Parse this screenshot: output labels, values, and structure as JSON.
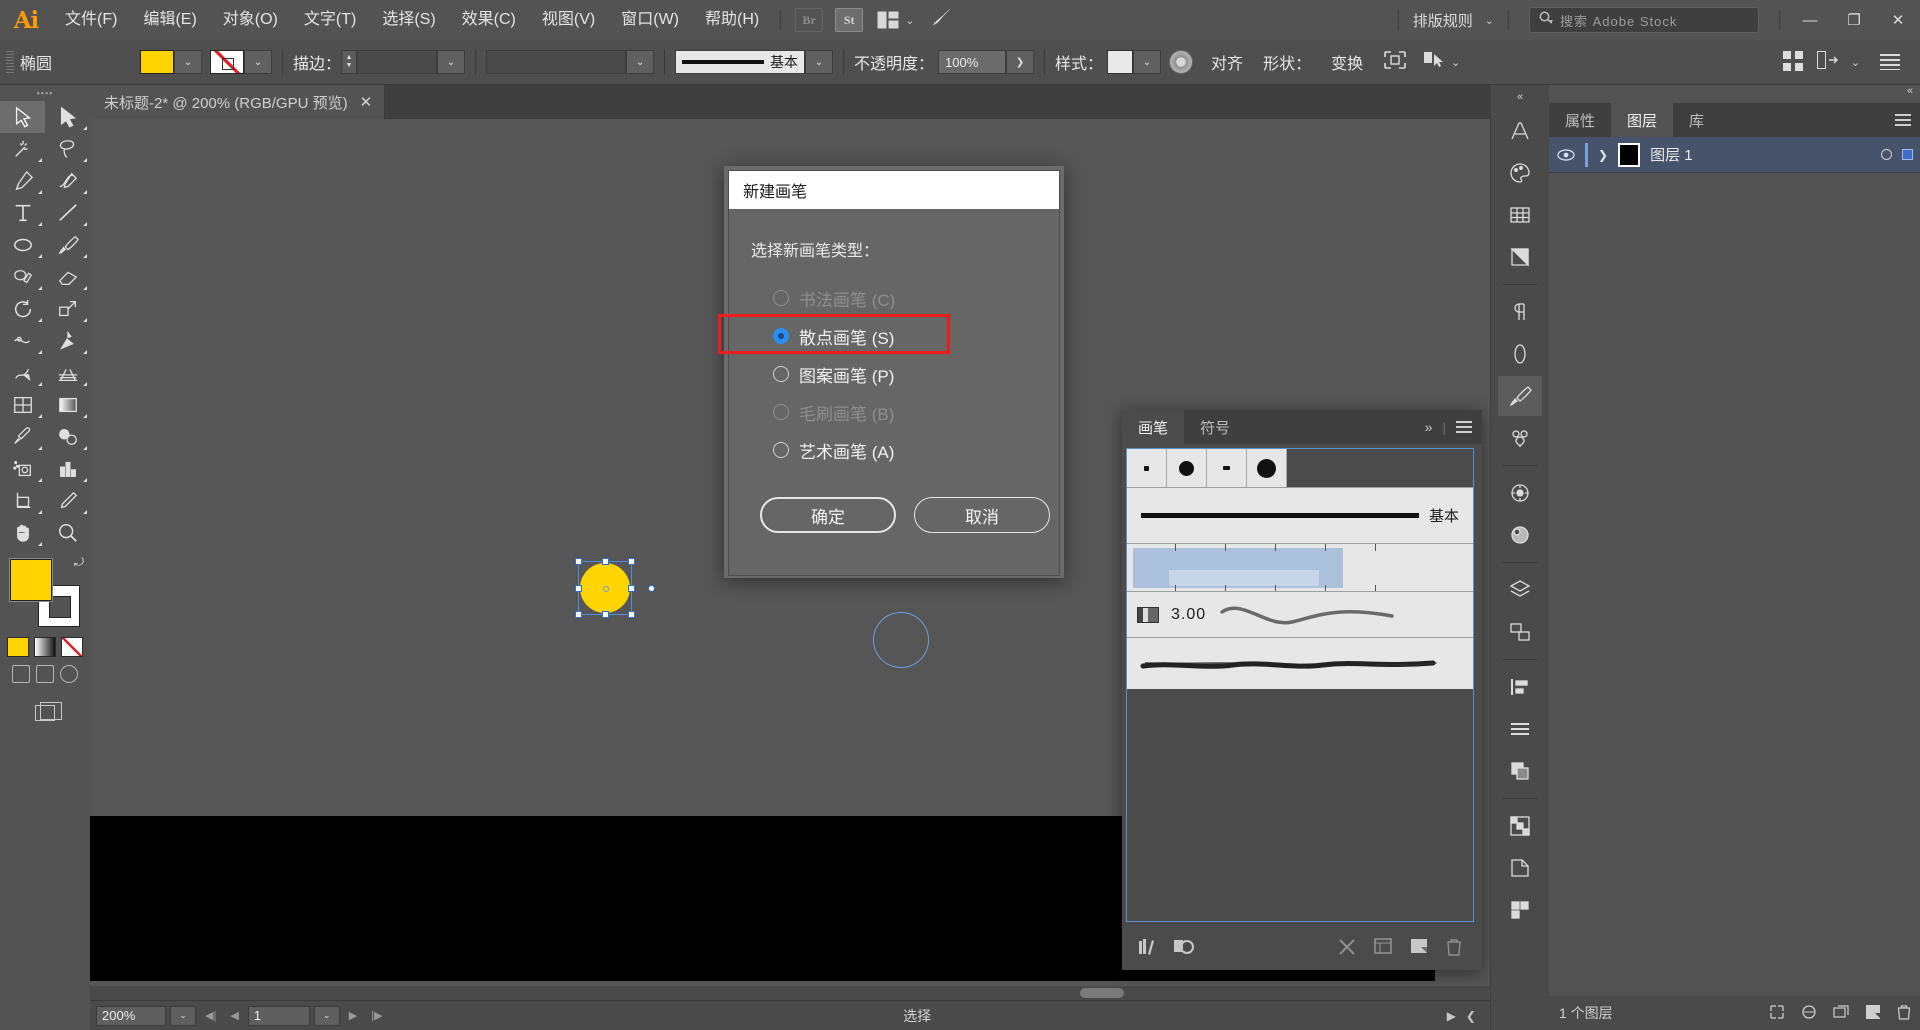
{
  "app": {
    "logo": "Ai"
  },
  "menubar": {
    "items": [
      {
        "label": "文件(F)"
      },
      {
        "label": "编辑(E)"
      },
      {
        "label": "对象(O)"
      },
      {
        "label": "文字(T)"
      },
      {
        "label": "选择(S)"
      },
      {
        "label": "效果(C)"
      },
      {
        "label": "视图(V)"
      },
      {
        "label": "窗口(W)"
      },
      {
        "label": "帮助(H)"
      }
    ],
    "bridge_label": "Br",
    "stock_label": "St",
    "arrange_chevron": "⌄",
    "rocket_icon": "rocket-icon",
    "workspace": "排版规则",
    "workspace_chevron": "⌄",
    "search_placeholder": "搜索 Adobe Stock",
    "minimize": "—",
    "restore": "❐",
    "close": "✕"
  },
  "controlbar": {
    "shape_label": "椭圆",
    "fill_color": "#ffd400",
    "stroke_swatch": "none",
    "stroke_label": "描边：",
    "stroke_weight": "",
    "stroke_profile": "",
    "brush_name": "基本",
    "opacity_label": "不透明度：",
    "opacity_value": "100%",
    "opacity_arrow": "❯",
    "style_label": "样式：",
    "recolor_icon": "recolor-artwork-icon",
    "align_label": "对齐",
    "shape_prop_label": "形状：",
    "transform_label": "变换",
    "isolate_icon": "isolate-icon",
    "select_similar_icon": "select-similar-icon",
    "select_similar_chevron": "⌄",
    "grid_icon": "document-grid-icon",
    "arrange_icon": "arrange-documents-icon",
    "panel_menu_icon": "panel-menu-icon"
  },
  "toolbar": {
    "tools": [
      {
        "name": "selection-tool",
        "selected": true
      },
      {
        "name": "direct-selection-tool",
        "selected": false
      },
      {
        "name": "magic-wand-tool",
        "selected": false
      },
      {
        "name": "lasso-tool",
        "selected": false
      },
      {
        "name": "pen-tool",
        "selected": false
      },
      {
        "name": "curvature-tool",
        "selected": false
      },
      {
        "name": "type-tool",
        "selected": false
      },
      {
        "name": "line-segment-tool",
        "selected": false
      },
      {
        "name": "ellipse-tool",
        "selected": false
      },
      {
        "name": "paintbrush-tool",
        "selected": false
      },
      {
        "name": "shaper-tool",
        "selected": false
      },
      {
        "name": "eraser-tool",
        "selected": false
      },
      {
        "name": "rotate-tool",
        "selected": false
      },
      {
        "name": "scale-tool",
        "selected": false
      },
      {
        "name": "width-tool",
        "selected": false
      },
      {
        "name": "free-transform-tool",
        "selected": false
      },
      {
        "name": "shape-builder-tool",
        "selected": false
      },
      {
        "name": "perspective-grid-tool",
        "selected": false
      },
      {
        "name": "mesh-tool",
        "selected": false
      },
      {
        "name": "gradient-tool",
        "selected": false
      },
      {
        "name": "eyedropper-tool",
        "selected": false
      },
      {
        "name": "blend-tool",
        "selected": false
      },
      {
        "name": "symbol-sprayer-tool",
        "selected": false
      },
      {
        "name": "column-graph-tool",
        "selected": false
      },
      {
        "name": "artboard-tool",
        "selected": false
      },
      {
        "name": "slice-tool",
        "selected": false
      },
      {
        "name": "hand-tool",
        "selected": false
      },
      {
        "name": "zoom-tool",
        "selected": false
      }
    ],
    "fill_color": "#ffd400",
    "stroke_color": "#ffffff"
  },
  "document": {
    "tab_title": "未标题-2* @ 200% (RGB/GPU 预览)",
    "tab_close": "✕"
  },
  "canvas": {
    "selected_object": "yellow-ellipse",
    "object_fill": "#ffd400",
    "blue_outline_circle": "blue-circle-outline"
  },
  "dialog": {
    "title": "新建画笔",
    "subtitle": "选择新画笔类型：",
    "options": [
      {
        "label": "书法画笔 (C)",
        "state": "disabled",
        "selected": false
      },
      {
        "label": "散点画笔 (S)",
        "state": "enabled",
        "selected": true
      },
      {
        "label": "图案画笔 (P)",
        "state": "enabled",
        "selected": false
      },
      {
        "label": "毛刷画笔 (B)",
        "state": "disabled",
        "selected": false
      },
      {
        "label": "艺术画笔 (A)",
        "state": "enabled",
        "selected": false
      }
    ],
    "ok_label": "确定",
    "cancel_label": "取消",
    "highlight_color": "#ee1c1c",
    "selected_radio_color": "#2d8cf0"
  },
  "brushes_panel": {
    "tabs": [
      {
        "label": "画笔",
        "active": true
      },
      {
        "label": "符号",
        "active": false
      }
    ],
    "expand_icon": "»",
    "menu_icon": "panel-menu-icon",
    "calligraphic_brushes": [
      "1 pt. 圆形",
      "3 pt. 圆形",
      "5 pt. 扁平",
      "10 pt. 圆形"
    ],
    "basic_brush_name": "基本",
    "art_brush_label": "art-brush-swatch",
    "bristle_size": "3.00",
    "bottom_icons": [
      "brush-libraries-icon",
      "libraries-icon",
      "remove-brush-stroke-icon",
      "options-of-selected-object-icon",
      "new-brush-icon",
      "delete-brush-icon"
    ]
  },
  "right_dock": {
    "rail_icons": [
      "character-panel-icon",
      "color-panel-icon",
      "swatches-panel-icon",
      "gradient-panel-icon",
      "paragraph-panel-icon",
      "stroke-panel-icon",
      "brushes-panel-icon",
      "symbols-panel-icon",
      "appearance-panel-icon",
      "graphic-styles-panel-icon",
      "layers-panel-icon",
      "artboards-panel-icon",
      "align-panel-icon",
      "transform-panel-icon",
      "pathfinder-panel-icon",
      "transparency-panel-icon",
      "asset-export-panel-icon"
    ],
    "tabs": [
      {
        "label": "属性",
        "active": false
      },
      {
        "label": "图层",
        "active": true
      },
      {
        "label": "库",
        "active": false
      }
    ],
    "menu_icon": "panel-menu-icon",
    "layers": [
      {
        "name": "图层 1",
        "visible": true,
        "selected": true,
        "expanded": false,
        "color": "#3b6ec9"
      }
    ],
    "footer_count": "1 个图层",
    "footer_icons": [
      "locate-object-icon",
      "make-clipping-mask-icon",
      "create-new-sublayer-icon",
      "create-new-layer-icon",
      "delete-selection-icon"
    ]
  },
  "statusbar": {
    "zoom": "200%",
    "zoom_chevron": "⌄",
    "first_page_icon": "◀|",
    "prev_page_icon": "◀",
    "page": "1",
    "page_chevron": "⌄",
    "next_page_icon": "▶",
    "last_page_icon": "|▶",
    "status_text": "选择",
    "next_icon": "▶",
    "prev_icon": "❮"
  }
}
